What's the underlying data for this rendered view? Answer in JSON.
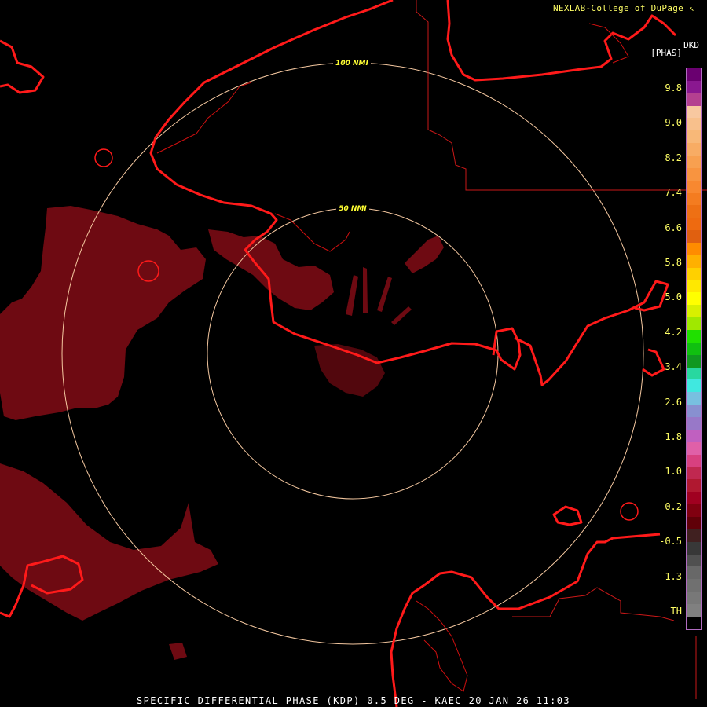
{
  "credit": "NEXLAB-College of DuPage",
  "credit_icon": "cursor-arrow-icon",
  "units": {
    "product": "DKD",
    "measure": "[PHAS]"
  },
  "range_rings": [
    {
      "label": "100 NMI"
    },
    {
      "label": "50 NMI"
    }
  ],
  "legend": {
    "ticks": [
      "9.8",
      "9.0",
      "8.2",
      "7.4",
      "6.6",
      "5.8",
      "5.0",
      "4.2",
      "3.4",
      "2.6",
      "1.8",
      "1.0",
      "0.2",
      "-0.5",
      "-1.3",
      "TH"
    ],
    "colors": [
      "#6a0070",
      "#8a1890",
      "#b44090",
      "#f8c8a0",
      "#f8c08c",
      "#f8b878",
      "#f8ac64",
      "#f8a050",
      "#f89440",
      "#f88830",
      "#f47c20",
      "#ee7014",
      "#ee6a10",
      "#e06010",
      "#ff8c00",
      "#ffb000",
      "#ffd000",
      "#ffe800",
      "#ffff00",
      "#d8f000",
      "#a0e800",
      "#20e000",
      "#10c010",
      "#109820",
      "#28d8a0",
      "#40e8e0",
      "#78c0e0",
      "#8890d0",
      "#9878c8",
      "#c060c0",
      "#e060a8",
      "#d84080",
      "#c02850",
      "#b01830",
      "#a00020",
      "#800010",
      "#600008",
      "#402020",
      "#383838",
      "#505050",
      "#686868",
      "#707070",
      "#787878",
      "#808080",
      "#000000"
    ]
  },
  "colors": {
    "background": "#000000",
    "coastline": "#ff1a1a",
    "ring": "#f5c8a0",
    "echo": "#6e0a12",
    "label": "#ffff66"
  },
  "footer": "SPECIFIC DIFFERENTIAL PHASE (KDP) 0.5 DEG - KAEC 20 JAN 26 11:03"
}
